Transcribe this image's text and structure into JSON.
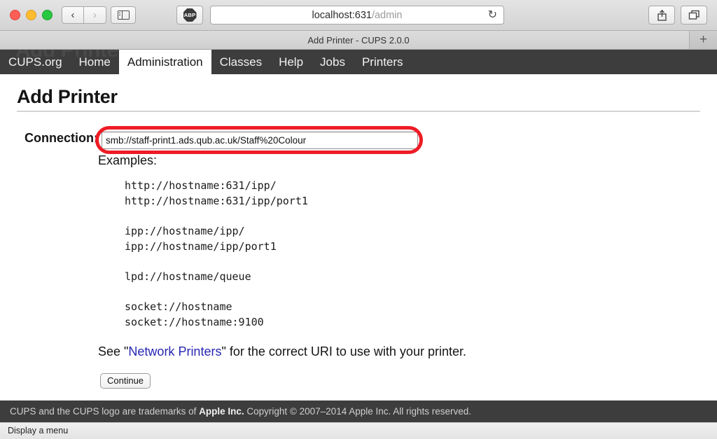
{
  "browser": {
    "window_controls": [
      "close",
      "minimize",
      "zoom"
    ],
    "back_label": "‹",
    "forward_label": "›",
    "extension_label": "ABP",
    "url_host": "localhost:631",
    "url_path": "/admin",
    "reload_label": "↻",
    "tab_title": "Add Printer - CUPS 2.0.0",
    "new_tab_label": "+"
  },
  "cups_nav": {
    "ghost_text": "Add Printer",
    "items": [
      {
        "label": "CUPS.org",
        "active": false
      },
      {
        "label": "Home",
        "active": false
      },
      {
        "label": "Administration",
        "active": true
      },
      {
        "label": "Classes",
        "active": false
      },
      {
        "label": "Help",
        "active": false
      },
      {
        "label": "Jobs",
        "active": false
      },
      {
        "label": "Printers",
        "active": false
      }
    ]
  },
  "page": {
    "title": "Add Printer",
    "connection_label": "Connection:",
    "connection_value": "smb://staff-print1.ads.qub.ac.uk/Staff%20Colour",
    "connection_placeholder": "",
    "examples_label": "Examples:",
    "example_groups": [
      [
        "http://hostname:631/ipp/",
        "http://hostname:631/ipp/port1"
      ],
      [
        "ipp://hostname/ipp/",
        "ipp://hostname/ipp/port1"
      ],
      [
        "lpd://hostname/queue"
      ],
      [
        "socket://hostname",
        "socket://hostname:9100"
      ]
    ],
    "see_prefix": "See \"",
    "see_link": "Network Printers",
    "see_suffix": "\" for the correct URI to use with your printer.",
    "continue_label": "Continue",
    "annotation_color": "#ee1c25"
  },
  "footer": {
    "text_before": "CUPS and the CUPS logo are trademarks of ",
    "text_bold": "Apple Inc.",
    "text_after": " Copyright © 2007–2014 Apple Inc. All rights reserved."
  },
  "statusbar": {
    "text": "Display a menu"
  }
}
